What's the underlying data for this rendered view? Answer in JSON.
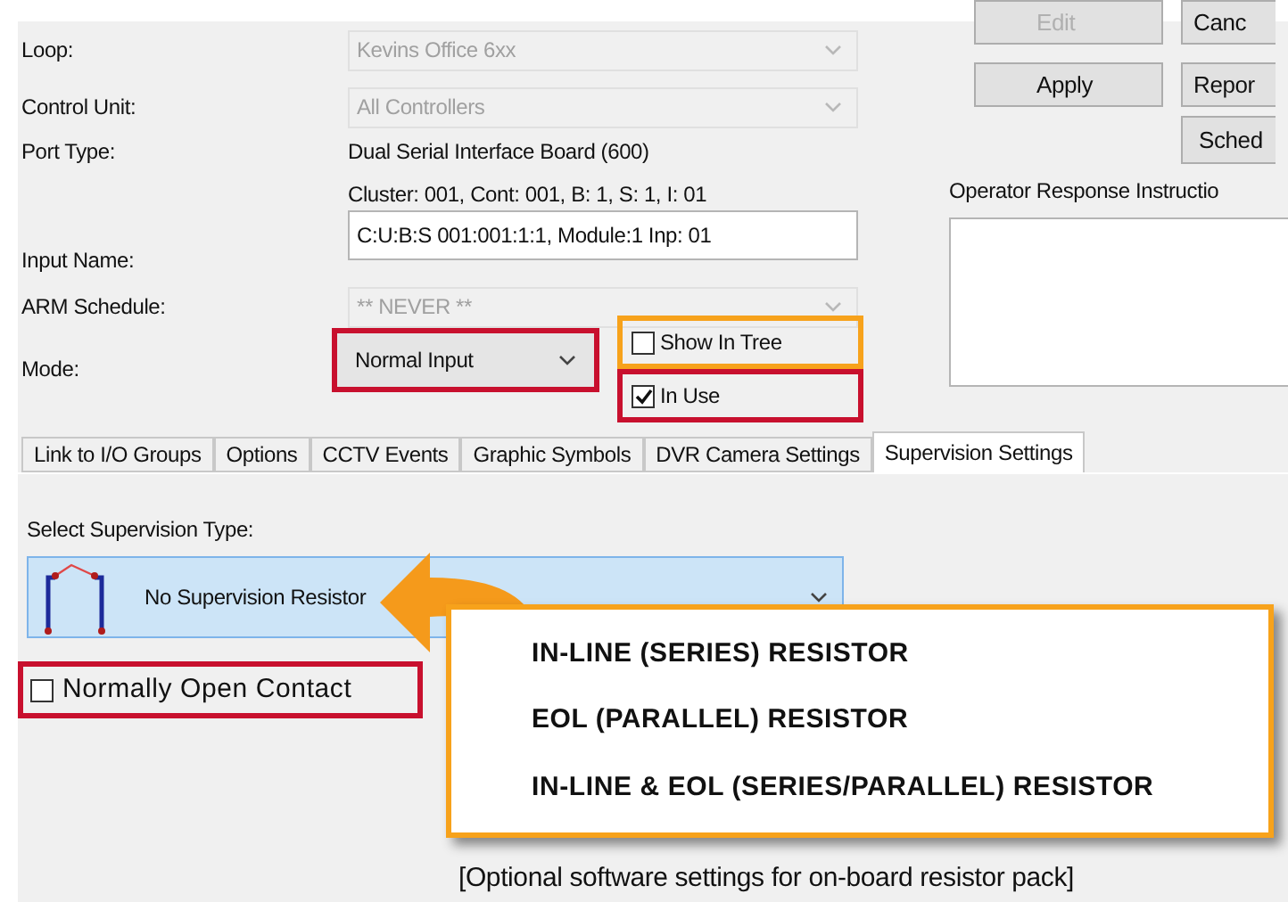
{
  "form": {
    "fields": [
      {
        "label": "Loop:",
        "kind": "combo",
        "value": "Kevins Office 6xx",
        "disabled": true
      },
      {
        "label": "Control Unit:",
        "kind": "combo",
        "value": "All Controllers",
        "disabled": true
      },
      {
        "label": "Port Type:",
        "kind": "info",
        "lines": [
          "Dual Serial Interface Board (600)",
          "Cluster: 001, Cont: 001, B: 1, S: 1, I: 01"
        ]
      },
      {
        "label": "Input Name:",
        "kind": "text",
        "value": "C:U:B:S 001:001:1:1, Module:1 Inp: 01",
        "disabled": false
      },
      {
        "label": "ARM Schedule:",
        "kind": "combo",
        "value": "** NEVER **",
        "disabled": true
      }
    ],
    "mode": {
      "label": "Mode:",
      "value": "Normal Input",
      "color": "#c8102e"
    },
    "checkboxes": [
      {
        "label": "Show In Tree",
        "checked": false,
        "color": "#f7a21b"
      },
      {
        "label": "In Use",
        "checked": true,
        "color": "#c8102e"
      }
    ]
  },
  "buttons": [
    {
      "label": "Edit",
      "disabled": true
    },
    {
      "label": "Canc",
      "disabled": false
    },
    {
      "label": "Apply",
      "disabled": false
    },
    {
      "label": "Repor",
      "disabled": false
    },
    {
      "label": "Sched",
      "disabled": false
    }
  ],
  "instructions": {
    "label": "Operator Response Instructio"
  },
  "tabs": [
    {
      "label": "Link to I/O Groups",
      "selected": false
    },
    {
      "label": "Options",
      "selected": false
    },
    {
      "label": "CCTV Events",
      "selected": false
    },
    {
      "label": "Graphic Symbols",
      "selected": false
    },
    {
      "label": "DVR Camera Settings",
      "selected": false
    },
    {
      "label": "Supervision Settings",
      "selected": true
    }
  ],
  "supervision": {
    "label": "Select Supervision Type:",
    "value": "No Supervision Resistor",
    "contact": {
      "label": "Normally Open Contact",
      "checked": false,
      "color": "#c8102e"
    },
    "options": [
      "IN-LINE (SERIES) RESISTOR",
      "EOL (PARALLEL) RESISTOR",
      "IN-LINE & EOL (SERIES/PARALLEL) RESISTOR"
    ],
    "note": "[Optional software settings for on-board resistor pack]"
  }
}
